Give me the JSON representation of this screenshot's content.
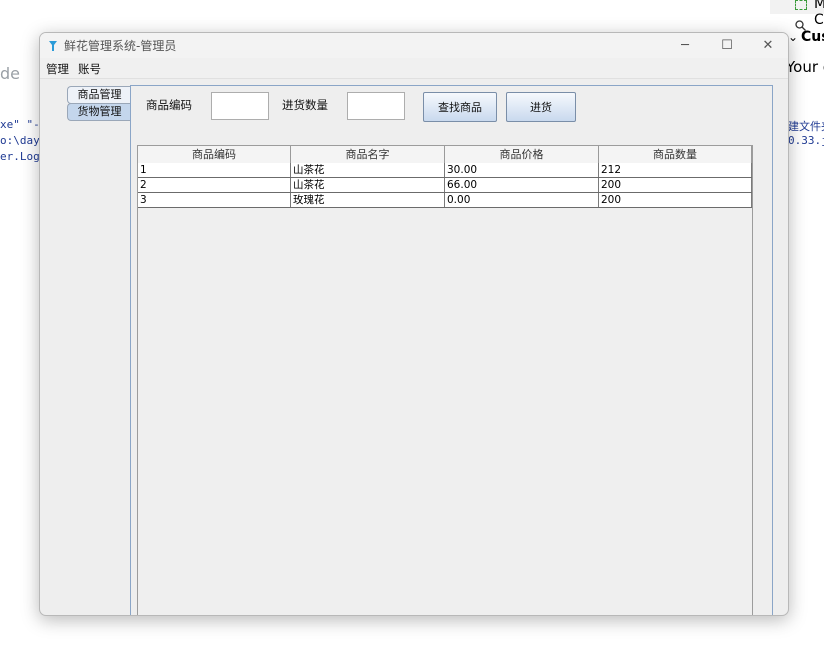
{
  "background": {
    "left_gray_text": "de",
    "code_lines": [
      "xe\" \"-j",
      "o:\\day-C",
      "er.Login"
    ],
    "right_code_lines": [
      "建文件夹",
      "0.33.j"
    ],
    "right_panel": {
      "item1": "M",
      "item2": "C",
      "cus_text": "Cus",
      "your_text": "Your e"
    }
  },
  "window": {
    "title": "鲜花管理系统-管理员",
    "controls": {
      "minimize": "─",
      "maximize": "☐",
      "close": "✕"
    }
  },
  "menu": [
    "管理",
    "账号"
  ],
  "tabs": [
    {
      "label": "商品管理",
      "selected": false
    },
    {
      "label": "货物管理",
      "selected": true
    }
  ],
  "form": {
    "code_label": "商品编码",
    "code_value": "",
    "qty_label": "进货数量",
    "qty_value": "",
    "find_button": "查找商品",
    "stock_button": "进货"
  },
  "table": {
    "headers": [
      "商品编码",
      "商品名字",
      "商品价格",
      "商品数量"
    ],
    "rows": [
      [
        "1",
        "山茶花",
        "30.00",
        "212"
      ],
      [
        "2",
        "山茶花",
        "66.00",
        "200"
      ],
      [
        "3",
        "玫瑰花",
        "0.00",
        "200"
      ]
    ]
  },
  "colors": {
    "tab_selected": "#c4d6ec",
    "content_border": "#8aa5c7"
  }
}
